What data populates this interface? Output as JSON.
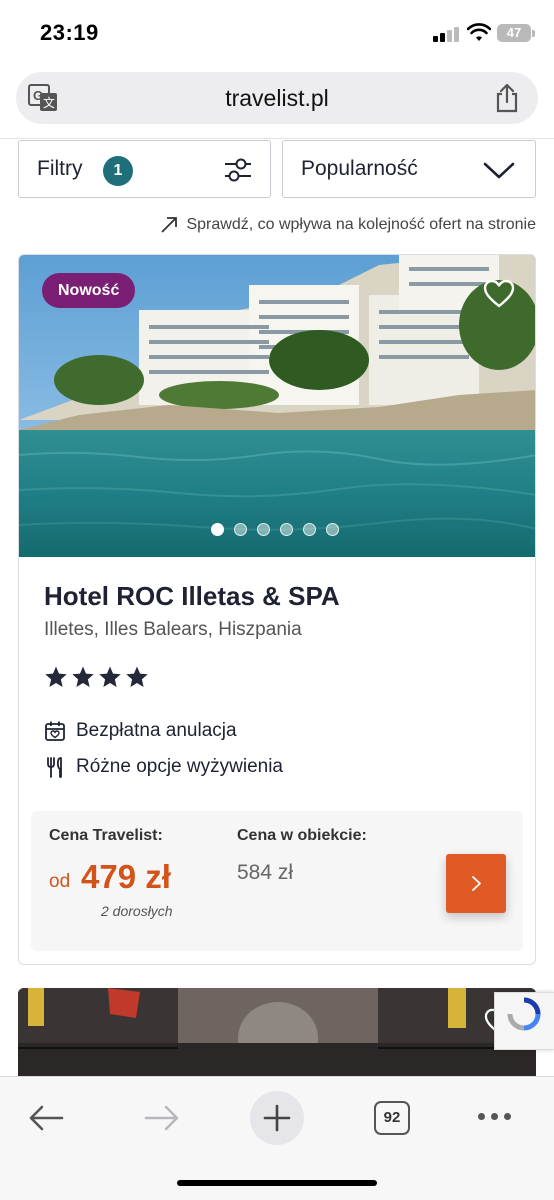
{
  "status_bar": {
    "time": "23:19",
    "battery": "47"
  },
  "browser": {
    "url": "travelist.pl"
  },
  "filters": {
    "filter_label": "Filtry",
    "filter_count": "1",
    "sort_label": "Popularność",
    "sort_info": "Sprawdź, co wpływa na kolejność ofert na stronie"
  },
  "offer": {
    "badge": "Nowość",
    "name": "Hotel ROC Illetas & SPA",
    "location": "Illetes, Illes Balears, Hiszpania",
    "stars": 4,
    "features": [
      "Bezpłatna anulacja",
      "Różne opcje wyżywienia"
    ],
    "price_label": "Cena Travelist:",
    "price_prefix": "od",
    "price_value": "479 zł",
    "price_guests": "2 dorosłych",
    "object_price_label": "Cena w obiekcie:",
    "object_price_value": "584 zł",
    "image_count": 6,
    "active_image": 1
  },
  "toolbar": {
    "tab_count": "92"
  },
  "colors": {
    "accent": "#e05a25",
    "price": "#d2541b",
    "badge": "#7a1f73",
    "filter_badge": "#1f6f7a"
  }
}
